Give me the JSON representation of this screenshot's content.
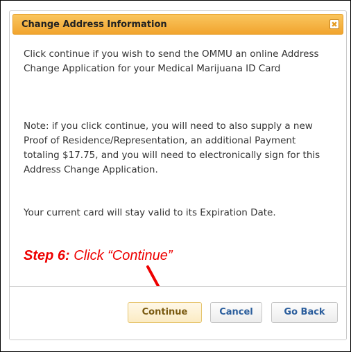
{
  "dialog": {
    "title": "Change Address Information",
    "close_glyph": "✖",
    "paragraphs": [
      "Click continue if you wish to send the OMMU an online Address Change Application for your Medical Marijuana ID Card",
      "Note: if you click continue, you will need to also supply a new Proof of Residence/Representation, an additional Payment totaling $17.75, and you will need to electronically sign for this Address Change Application.",
      "Your current card will stay valid to its Expiration Date."
    ],
    "buttons": {
      "continue": "Continue",
      "cancel": "Cancel",
      "go_back": "Go Back"
    }
  },
  "annotation": {
    "step_label": "Step 6:",
    "step_text": " Click “Continue”",
    "color": "#ee0000"
  },
  "colors": {
    "titlebar": "#f1a42e",
    "button_text": "#2a5d9c"
  }
}
